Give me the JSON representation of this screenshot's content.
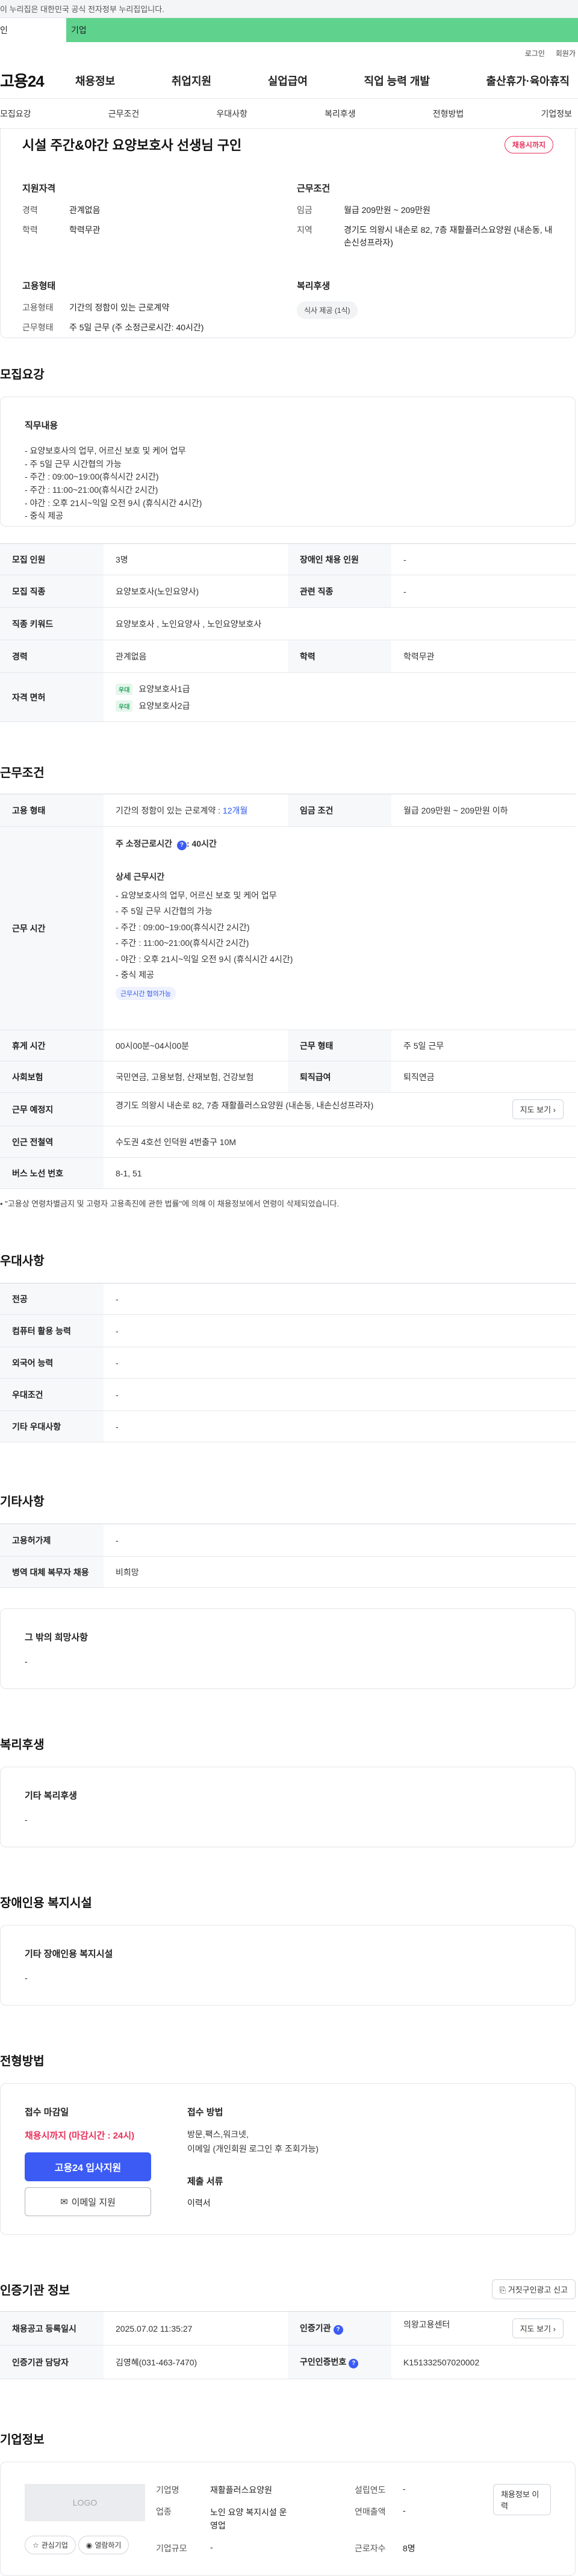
{
  "gov_banner": "이 누리집은 대한민국 공식 전자정부 누리집입니다.",
  "user_tabs": [
    "인",
    "기업"
  ],
  "util_links": [
    "로그인",
    "회원가"
  ],
  "gnb": {
    "logo": "고용24",
    "items": [
      "채용정보",
      "취업지원",
      "실업급여",
      "직업 능력 개발",
      "출산휴가·육아휴직"
    ]
  },
  "anchor_nav": [
    "모집요강",
    "근무조건",
    "우대사항",
    "복리후생",
    "전형방법",
    "기업정보"
  ],
  "job": {
    "title": "시설 주간&야간 요양보호사 선생님 구인",
    "status_badge": "채용시까지",
    "summary": {
      "qual_head": "지원자격",
      "qual": [
        {
          "k": "경력",
          "v": "관계없음"
        },
        {
          "k": "학력",
          "v": "학력무관"
        }
      ],
      "work_head": "근무조건",
      "work": [
        {
          "k": "임금",
          "v": "월급 209만원 ~ 209만원"
        },
        {
          "k": "지역",
          "v": "경기도 의왕시 내손로 82, 7층 재활플러스요양원 (내손동, 내손신성프라자)"
        }
      ],
      "type_head": "고용형태",
      "type": [
        {
          "k": "고용형태",
          "v": "기간의 정함이 있는 근로계약"
        },
        {
          "k": "근무형태",
          "v": "주 5일 근무 (주 소정근로시간: 40시간)"
        }
      ],
      "welfare_head": "복리후생",
      "welfare_chip": "식사 제공 (1식)"
    }
  },
  "recruit": {
    "title": "모집요강",
    "duty_head": "직무내용",
    "duty_lines": [
      "- 요양보호사의 업무, 어르신 보호 및 케어 업무",
      "- 주 5일 근무 시간협의 가능",
      "- 주간 : 09:00~19:00(휴식시간 2시간)",
      "- 주간 : 11:00~21:00(휴식시간 2시간)",
      "- 야간 : 오후 21시~익일 오전 9시  (휴식시간 4시간)",
      "- 중식 제공"
    ],
    "rows": {
      "count_k": "모집 인원",
      "count_v": "3명",
      "disabled_k": "장애인 채용 인원",
      "disabled_v": "-",
      "job_k": "모집 직종",
      "job_v": "요양보호사(노인요양사)",
      "rel_k": "관련 직종",
      "rel_v": "-",
      "kw_k": "직종 키워드",
      "kw_v": "요양보호사 , 노인요양사 , 노인요양보호사",
      "career_k": "경력",
      "career_v": "관계없음",
      "edu_k": "학력",
      "edu_v": "학력무관",
      "cert_k": "자격 면허",
      "cert_tag": "우대",
      "certs": [
        "요양보호사1급",
        "요양보호사2급"
      ]
    }
  },
  "conditions": {
    "title": "근무조건",
    "emp_k": "고용 형태",
    "emp_v1": "기간의 정함이 있는 근로계약 : ",
    "emp_v2": "12개월",
    "wage_k": "임금 조건",
    "wage_v": "월급 209만원 ~ 209만원 이하",
    "hours_k": "근무 시간",
    "hours_weekly": "주 소정근로시간",
    "hours_weekly_v": ": 40시간",
    "hours_detail_head": "상세 근무시간",
    "hours_detail": [
      "- 요양보호사의 업무, 어르신 보호 및 케어 업무",
      "- 주 5일 근무 시간협의 가능",
      "- 주간 : 09:00~19:00(휴식시간 2시간)",
      "- 주간 : 11:00~21:00(휴식시간 2시간)",
      "- 야간 : 오후 21시~익일 오전 9시  (휴식시간 4시간)",
      "- 중식 제공"
    ],
    "hours_chip": "근무시간 협의가능",
    "rest_k": "휴게 시간",
    "rest_v": "00시00분~04시00분",
    "form_k": "근무 형태",
    "form_v": "주 5일 근무",
    "ins_k": "사회보험",
    "ins_v": "국민연금, 고용보험, 산재보험, 건강보험",
    "ret_k": "퇴직급여",
    "ret_v": "퇴직연금",
    "place_k": "근무 예정지",
    "place_v": "경기도 의왕시 내손로 82, 7층 재활플러스요양원 (내손동, 내손신성프라자)",
    "map_btn": "지도 보기",
    "sub_k": "인근 전철역",
    "sub_v": "수도권 4호선 인덕원 4번출구 10M",
    "bus_k": "버스 노선 번호",
    "bus_v": "8-1, 51",
    "note": "\"고용상 연령차별금지 및 고령자 고용촉진에 관한 법률\"에 의해 이 채용정보에서 연령이 삭제되었습니다."
  },
  "pref": {
    "title": "우대사항",
    "rows": [
      {
        "k": "전공",
        "v": "-"
      },
      {
        "k": "컴퓨터 활용 능력",
        "v": "-"
      },
      {
        "k": "외국어 능력",
        "v": "-"
      },
      {
        "k": "우대조건",
        "v": "-"
      },
      {
        "k": "기타 우대사항",
        "v": "-"
      }
    ]
  },
  "etc": {
    "title": "기타사항",
    "rows": [
      {
        "k": "고용허가제",
        "v": "-"
      },
      {
        "k": "병역 대체 복무자 채용",
        "v": "비희망"
      }
    ],
    "hope_head": "그 밖의 희망사항",
    "hope_v": "-"
  },
  "welfare": {
    "title": "복리후생",
    "head": "기타 복리후생",
    "v": "-"
  },
  "facility": {
    "title": "장애인용 복지시설",
    "head": "기타 장애인용 복지시설",
    "v": "-"
  },
  "apply": {
    "title": "전형방법",
    "deadline_head": "접수 마감일",
    "deadline": "채용시까지 (마감시간 : 24시)",
    "apply_btn": "고용24 입사지원",
    "email_btn": "이메일 지원",
    "method_head": "접수 방법",
    "method_v1": "방문,팩스,워크넷,",
    "method_v2": "이메일 (개인회원 로그인 후 조회가능)",
    "docs_head": "제출 서류",
    "docs_v": "이력서"
  },
  "agency": {
    "title": "인증기관 정보",
    "report_btn": "거짓구인광고 신고",
    "reg_k": "채용공고 등록일시",
    "reg_v": "2025.07.02 11:35:27",
    "org_k": "인증기관",
    "org_v": "의왕고용센터",
    "map_btn": "지도 보기",
    "mgr_k": "인증기관 담당자",
    "mgr_v": "김영혜(031-463-7470)",
    "no_k": "구인인증번호",
    "no_v": "K151332507020002"
  },
  "company": {
    "title": "기업정보",
    "logo_text": "LOGO",
    "fav_btn": "관심기업",
    "list_btn": "열람하기",
    "info_btn": "채용정보 이력",
    "rows": {
      "name_k": "기업명",
      "name_v": "재활플러스요양원",
      "est_k": "설립연도",
      "est_v": "-",
      "ind_k": "업종",
      "ind_v": "노인 요양 복지시설 운영업",
      "sales_k": "연매출액",
      "sales_v": "-",
      "emp_k": "근로자수",
      "emp_v": "8명",
      "size_k": "기업규모",
      "size_v": "-"
    }
  }
}
